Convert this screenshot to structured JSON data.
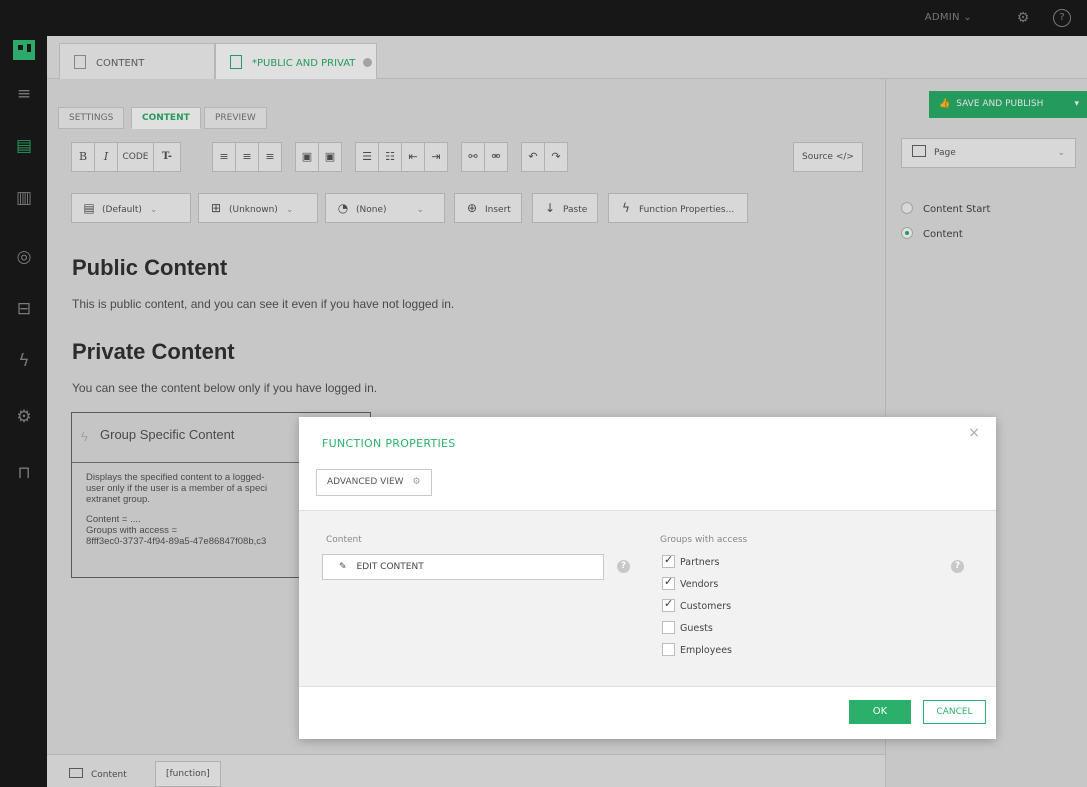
{
  "topbar": {
    "user": "ADMIN",
    "user_chevron": "⌄",
    "settings_icon": "gear-icon",
    "help_icon": "help-icon"
  },
  "rail": {
    "items": [
      "menu-icon",
      "document-icon",
      "film-icon",
      "database-icon",
      "layout-icon",
      "function-icon",
      "gear-icon",
      "lock-icon"
    ]
  },
  "tabs": [
    {
      "label": "CONTENT",
      "active": false
    },
    {
      "label": "*PUBLIC AND PRIVAT",
      "active": true
    }
  ],
  "subtabs": [
    "SETTINGS",
    "CONTENT",
    "PREVIEW"
  ],
  "save_publish": "SAVE AND PUBLISH",
  "format_toolbar": {
    "bold": "B",
    "italic": "I",
    "code": "CODE",
    "clear": "T-",
    "source": "Source </>"
  },
  "insert_toolbar": {
    "default": "(Default)",
    "unknown": "(Unknown)",
    "none": "(None)",
    "insert": "Insert",
    "paste": "Paste",
    "function_properties": "Function Properties..."
  },
  "editor": {
    "h1_public": "Public Content",
    "p_public": "This is public content, and you can see it even if you have not logged in.",
    "h1_private": "Private Content",
    "p_private": "You can see the content below only if you have logged in.",
    "function_title": "Group Specific Content",
    "function_desc_1": "Displays the specified content to a logged-",
    "function_desc_2": "user only if the user is a member of a speci",
    "function_desc_3": "extranet group.",
    "function_content": "Content = ....",
    "function_groups": "Groups with access =",
    "function_guid": "8fff3ec0-3737-4f94-89a5-47e86847f08b,c3"
  },
  "footer": {
    "tab1": "Content",
    "tab2": "[function]"
  },
  "sidepanel": {
    "select": "Page",
    "items": [
      {
        "label": "Content Start",
        "selected": false
      },
      {
        "label": "Content",
        "selected": true
      }
    ]
  },
  "modal": {
    "title": "FUNCTION PROPERTIES",
    "close": "×",
    "advanced_view": "ADVANCED VIEW",
    "content_label": "Content",
    "edit_content": "EDIT CONTENT",
    "groups_label": "Groups with access",
    "groups": [
      {
        "label": "Partners",
        "checked": true
      },
      {
        "label": "Vendors",
        "checked": true
      },
      {
        "label": "Customers",
        "checked": true
      },
      {
        "label": "Guests",
        "checked": false
      },
      {
        "label": "Employees",
        "checked": false
      }
    ],
    "help": "?",
    "ok": "OK",
    "cancel": "CANCEL"
  },
  "colors": {
    "accent": "#2ab06a",
    "dark": "#1b1b1b",
    "panel": "#e3e3e3"
  }
}
